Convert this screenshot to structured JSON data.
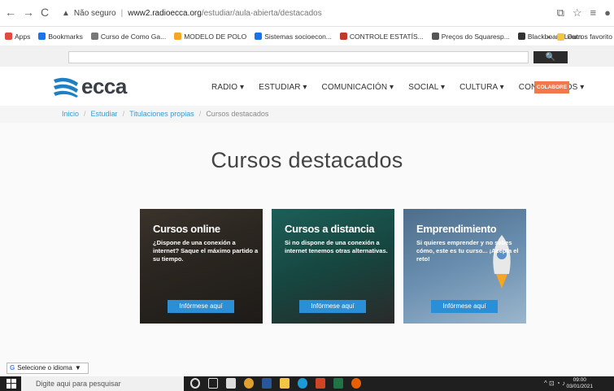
{
  "browser": {
    "back": "←",
    "forward": "→",
    "reload": "C",
    "security_warning": "Não seguro",
    "url_host": "www2.radioecca.org",
    "url_path": "/estudiar/aula-abierta/destacados"
  },
  "bookmarks": [
    {
      "label": "Apps",
      "color": "#e04a3f"
    },
    {
      "label": "Bookmarks",
      "color": "#1a73e8"
    },
    {
      "label": "Curso de Como Ga...",
      "color": "#777777"
    },
    {
      "label": "MODELO DE POLO",
      "color": "#f5a623"
    },
    {
      "label": "Sistemas socioecon...",
      "color": "#1a73e8"
    },
    {
      "label": "CONTROLE ESTATÍS...",
      "color": "#c0392b"
    },
    {
      "label": "Preços do Squaresp...",
      "color": "#555555"
    },
    {
      "label": "Blackboard Learn",
      "color": "#333333"
    }
  ],
  "bookmarks_more": "»",
  "other_favorites": "Outros favorito",
  "search_button": "🔍",
  "site": {
    "logo": "ecca",
    "menu": [
      "RADIO ▾",
      "ESTUDIAR ▾",
      "COMUNICACIÓN ▾",
      "SOCIAL ▾",
      "CULTURA ▾",
      "CONÓZCANOS ▾"
    ],
    "colabore": "COLABORE"
  },
  "breadcrumb": {
    "items": [
      "Inicio",
      "Estudiar",
      "Titulaciones propias"
    ],
    "current": "Cursos destacados",
    "separator": "/"
  },
  "page_title": "Cursos destacados",
  "cards": [
    {
      "title": "Cursos online",
      "desc": "¿Dispone de una conexión a internet? Saque el máximo partido a su tiempo.",
      "button": "Infórmese aquí"
    },
    {
      "title": "Cursos a distancia",
      "desc": "Si no dispone de una conexión a internet tenemos otras alternativas.",
      "button": "Infórmese aquí"
    },
    {
      "title": "Emprendimiento",
      "desc": "Si quieres emprender y no sabes cómo, este es tu curso... ¡Acepta el reto!",
      "button": "Infórmese aquí"
    }
  ],
  "language_selector": "Selecione o idioma",
  "taskbar": {
    "search_placeholder": "Digite aqui para pesquisar",
    "time": "09:00",
    "date": "03/01/2021"
  }
}
